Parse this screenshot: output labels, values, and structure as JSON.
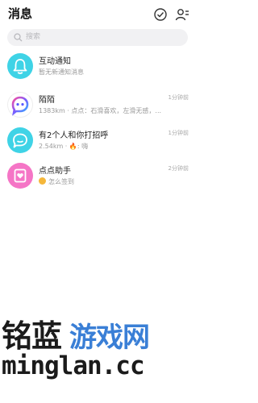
{
  "header": {
    "title": "消息"
  },
  "search": {
    "placeholder": "搜索"
  },
  "messages": [
    {
      "name": "互动通知",
      "preview": "暂无新通知消息",
      "time": ""
    },
    {
      "name": "陌陌",
      "preview": "1383km · 点点：石滑喜欢，左滑无感，...",
      "time": "1分钟前"
    },
    {
      "name": "有2个人和你打招呼",
      "distance": "2.54km · ",
      "preview_text": ": 嗨",
      "time": "1分钟前"
    },
    {
      "name": "点点助手",
      "preview": "怎么签到",
      "time": "2分钟前"
    }
  ],
  "watermark": {
    "line1a": "铭蓝",
    "line1b": "游戏网",
    "line2": "minglan.cc"
  },
  "colors": {
    "cyan": "#3fd3e6",
    "pink": "#f575c6",
    "watermark_blue": "#3a7fd6"
  }
}
